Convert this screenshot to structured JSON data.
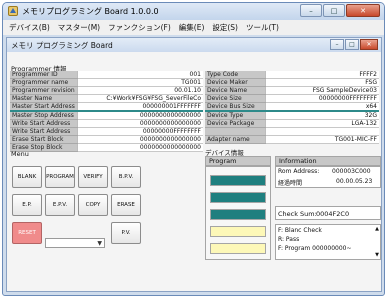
{
  "window": {
    "title": "メモリプログラミング Board 1.0.0.0",
    "controls": [
      "–",
      "□",
      "✕"
    ]
  },
  "menubar": [
    "デバイス(B)",
    "マスター(M)",
    "ファンクション(F)",
    "編集(E)",
    "設定(S)",
    "ツール(T)"
  ],
  "inner": {
    "title": "メモリ プログラミング Board",
    "controls": [
      "–",
      "□",
      "✕"
    ]
  },
  "programmer_info": {
    "heading": "Programmer 情報",
    "left_rows": [
      {
        "label": "Programmer ID",
        "value": "001"
      },
      {
        "label": "Programmer name",
        "value": "TG001"
      },
      {
        "label": "Programmer revision",
        "value": "00.01.10"
      },
      {
        "label": "Master Name",
        "value": "C:¥Work¥FSG¥FSG_SeverFileCo"
      },
      {
        "label": "Master Start Address",
        "value": "000000001FFFFFFF"
      },
      {
        "label": "Master Stop Address",
        "value": "0000000000000000"
      },
      {
        "label": "Write Start Address",
        "value": "0000000000000000"
      },
      {
        "label": "Write Start Address",
        "value": "00000000FFFFFFFF"
      },
      {
        "label": "Erase Start Block",
        "value": "0000000000000000"
      },
      {
        "label": "Erase Stop Block",
        "value": "0000000000000000"
      }
    ],
    "right_rows": [
      {
        "label": "Type Code",
        "value": "FFFF2"
      },
      {
        "label": "Device Maker",
        "value": "FSG"
      },
      {
        "label": "Device Name",
        "value": "FSG SampleDevice03"
      },
      {
        "label": "Device Size",
        "value": "00000000FFFFFFFF"
      },
      {
        "label": "Device Bus Size",
        "value": "x64"
      },
      {
        "label": "Device Type",
        "value": "32G"
      },
      {
        "label": "Device Package",
        "value": "LGA-132"
      },
      {
        "label": "",
        "value": ""
      },
      {
        "label": "Adapter name",
        "value": "TG001-MIC-FF"
      }
    ]
  },
  "menu_panel": {
    "heading": "Menu",
    "buttons_row1": [
      "BLANK",
      "PROGRAM",
      "VERIFY",
      "B.P.V."
    ],
    "buttons_row2": [
      "E.P.",
      "E.P.V.",
      "COPY",
      "ERASE"
    ],
    "reset_label": "RESET",
    "pv_label": "P.V.",
    "combo_value": ""
  },
  "device_info": {
    "heading": "デバイス情報",
    "program_col": "Program",
    "information_col": "Information",
    "progress": [
      1.0,
      1.0,
      1.0,
      0.0,
      0.0
    ],
    "rom_address_label": "Rom Address:",
    "rom_address_value": "000003C000",
    "elapsed_label": "経過時間",
    "elapsed_value": "00.00.05.23",
    "checksum_label": "Check Sum:",
    "checksum_value": "0004F2C0",
    "log_lines": [
      "F: Blanc Check",
      "R: Pass",
      "F: Program 000000000~"
    ]
  },
  "colors": {
    "accent_teal": "#1f7f7f",
    "progress_pending": "#fdf8b8",
    "reset_red": "#f08b8b"
  }
}
